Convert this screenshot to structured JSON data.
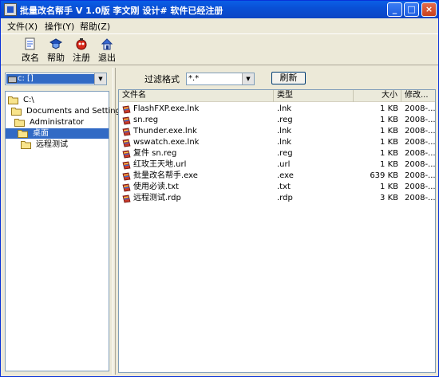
{
  "window": {
    "title": "批量改名帮手  V 1.0版  李文刚 设计# 软件已经注册",
    "min_glyph": "_",
    "max_glyph": "□",
    "close_glyph": "×"
  },
  "menu": [
    {
      "label": "文件(X)"
    },
    {
      "label": "操作(Y)"
    },
    {
      "label": "帮助(Z)"
    }
  ],
  "toolbar": [
    {
      "label": "改名",
      "icon": "rename-icon"
    },
    {
      "label": "帮助",
      "icon": "help-icon"
    },
    {
      "label": "注册",
      "icon": "register-icon"
    },
    {
      "label": "退出",
      "icon": "exit-icon"
    }
  ],
  "drive": {
    "value": "c: []"
  },
  "tree": [
    {
      "label": "C:\\",
      "selected": false
    },
    {
      "label": "Documents and Settings",
      "selected": false
    },
    {
      "label": "Administrator",
      "selected": false
    },
    {
      "label": "桌面",
      "selected": true
    },
    {
      "label": "远程测试",
      "selected": false
    }
  ],
  "filter": {
    "label": "过滤格式",
    "value": "*.*",
    "refresh_label": "刷新"
  },
  "list": {
    "columns": {
      "name": "文件名",
      "type": "类型",
      "size": "大小",
      "modified": "修改..."
    },
    "rows": [
      {
        "name": "FlashFXP.exe.lnk",
        "type": ".lnk",
        "size": "1 KB",
        "modified": "2008-..."
      },
      {
        "name": "sn.reg",
        "type": ".reg",
        "size": "1 KB",
        "modified": "2008-..."
      },
      {
        "name": "Thunder.exe.lnk",
        "type": ".lnk",
        "size": "1 KB",
        "modified": "2008-..."
      },
      {
        "name": "wswatch.exe.lnk",
        "type": ".lnk",
        "size": "1 KB",
        "modified": "2008-..."
      },
      {
        "name": "复件 sn.reg",
        "type": ".reg",
        "size": "1 KB",
        "modified": "2008-..."
      },
      {
        "name": "红玫王天地.url",
        "type": ".url",
        "size": "1 KB",
        "modified": "2008-..."
      },
      {
        "name": "批量改名帮手.exe",
        "type": ".exe",
        "size": "639 KB",
        "modified": "2008-..."
      },
      {
        "name": "使用必读.txt",
        "type": ".txt",
        "size": "1 KB",
        "modified": "2008-..."
      },
      {
        "name": "远程测试.rdp",
        "type": ".rdp",
        "size": "3 KB",
        "modified": "2008-..."
      }
    ]
  },
  "colors": {
    "titlebar": "#0a50d6",
    "selection": "#316ac5",
    "face": "#ece9d8"
  }
}
